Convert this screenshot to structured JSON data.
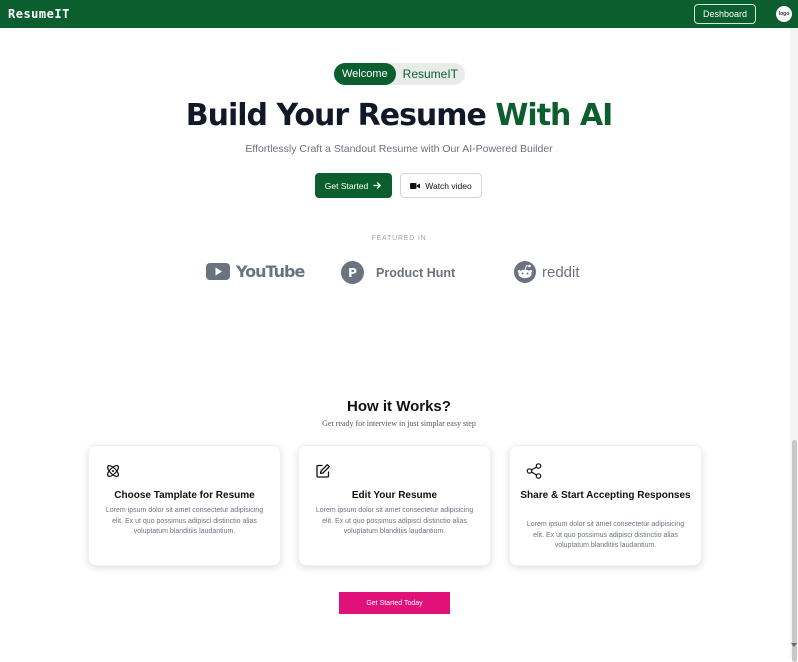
{
  "header": {
    "brand": "ResumeIT",
    "dashboard_label": "Deshboard",
    "avatar_text": "logo"
  },
  "hero": {
    "pill_tag": "Welcome",
    "pill_text": "ResumeIT",
    "title_main": "Build Your Resume ",
    "title_accent": "With AI",
    "subtitle": "Effortlessly Craft a Standout Resume with Our AI-Powered Builder",
    "get_started_label": "Get Started",
    "watch_video_label": "Watch video",
    "accent_color": "#0b5e2e"
  },
  "featured": {
    "label": "FEATURED IN",
    "logos": [
      {
        "name": "YouTube",
        "icon": "youtube-icon"
      },
      {
        "name": "Product Hunt",
        "icon": "product-hunt-icon"
      },
      {
        "name": "reddit",
        "icon": "reddit-icon"
      }
    ]
  },
  "how": {
    "title": "How it Works?",
    "subtitle": "Get ready for interview in just simplar easy step",
    "cards": [
      {
        "title": "Choose Tamplate for Resume",
        "icon": "atom-icon",
        "text": "Lorem ipsum dolor sit amet consectetur adipisicing elit. Ex ut quo possimus adipisci distinctio alias voluptatum blanditiis laudantium."
      },
      {
        "title": "Edit Your Resume",
        "icon": "edit-icon",
        "text": "Lorem ipsum dolor sit amet consectetur adipisicing elit. Ex ut quo possimus adipisci distinctio alias voluptatum blanditiis laudantium."
      },
      {
        "title": "Share & Start Accepting Responses",
        "icon": "share-icon",
        "text": "Lorem ipsum dolor sit amet consectetur adipisicing elit. Ex ut quo possimus adipisci distinctio alias voluptatum blanditiis laudantium."
      }
    ],
    "cta_label": "Get Started Today",
    "cta_color": "#e0127a"
  }
}
